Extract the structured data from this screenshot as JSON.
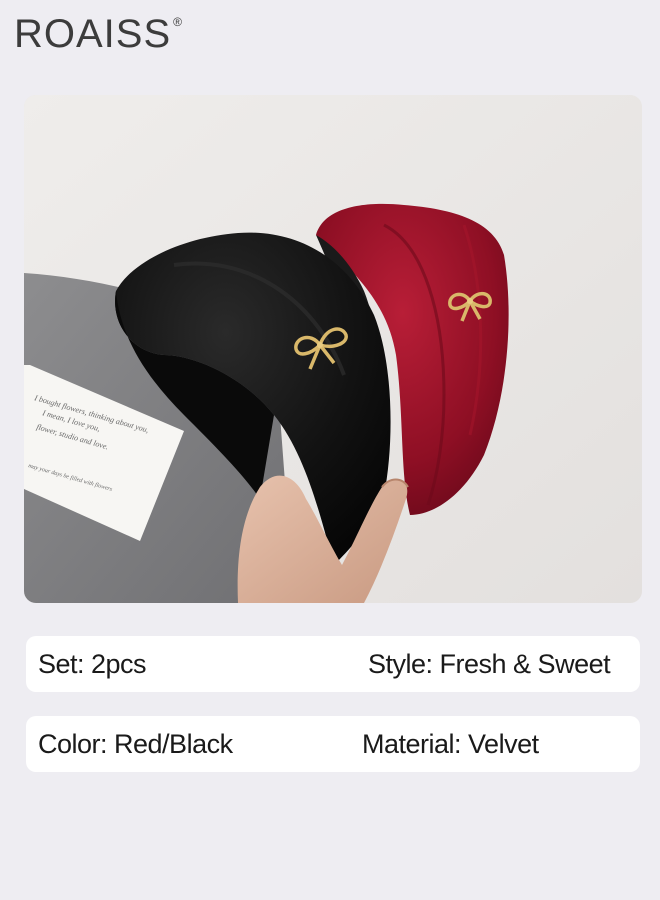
{
  "brand": {
    "name": "ROAISS",
    "registered_mark": "®"
  },
  "photo": {
    "card_lines": [
      "I bought flowers, thinking about you,",
      "I mean, I love you,",
      "flower, studio and love.",
      "may your days be filled with flowers"
    ],
    "colors": {
      "background": "#e8e6e4",
      "red_headband": "#8e0f24",
      "black_headband": "#111111",
      "gold_bow": "#d9b86a"
    }
  },
  "specs": {
    "set": {
      "label": "Set:",
      "value": "2pcs",
      "text": "Set:  2pcs"
    },
    "style": {
      "label": "Style:",
      "value": "Fresh & Sweet",
      "text": "Style: Fresh & Sweet"
    },
    "color": {
      "label": "Color:",
      "value": "Red/Black",
      "text": "Color: Red/Black"
    },
    "material": {
      "label": "Material:",
      "value": "Velvet",
      "text": "Material: Velvet"
    }
  }
}
